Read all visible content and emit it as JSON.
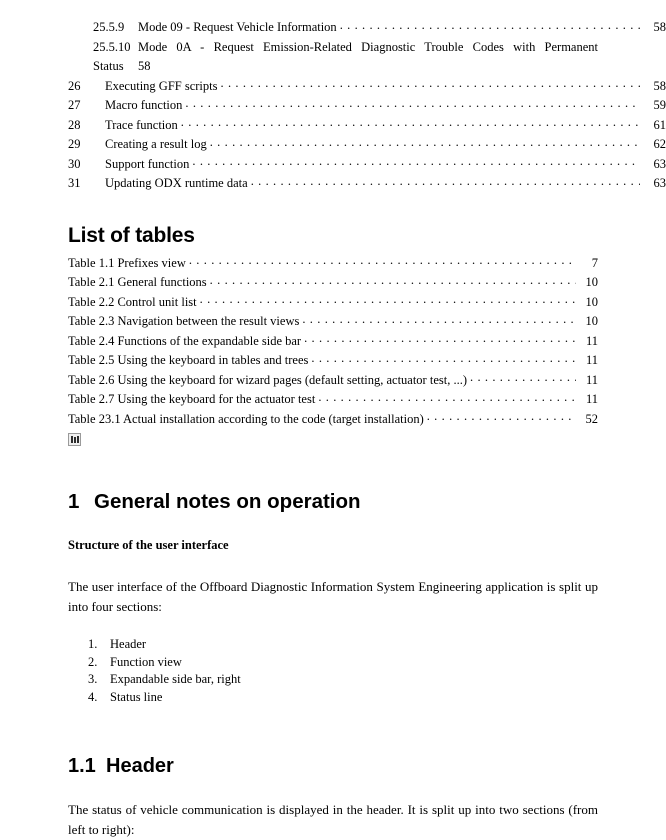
{
  "document": {
    "toc_continued": {
      "sub_entries": [
        {
          "number": "25.5.9",
          "title": "Mode 09 - Request Vehicle Information",
          "page": "58"
        }
      ],
      "wrapped_entry": {
        "number": "25.5.10",
        "title_line1": "Mode 0A - Request Emission-Related Diagnostic Trouble Codes with Permanent",
        "title_line2": "Status",
        "page": "58"
      },
      "chapter_entries": [
        {
          "number": "26",
          "title": "Executing GFF scripts",
          "page": "58"
        },
        {
          "number": "27",
          "title": "Macro function",
          "page": "59"
        },
        {
          "number": "28",
          "title": "Trace function",
          "page": "61"
        },
        {
          "number": "29",
          "title": "Creating a result log",
          "page": "62"
        },
        {
          "number": "30",
          "title": "Support function",
          "page": "63"
        },
        {
          "number": "31",
          "title": "Updating ODX runtime data",
          "page": "63"
        }
      ]
    },
    "list_of_tables": {
      "heading": "List of tables",
      "entries": [
        {
          "title": "Table 1.1 Prefixes view",
          "page": "7"
        },
        {
          "title": "Table 2.1 General functions",
          "page": "10"
        },
        {
          "title": "Table 2.2 Control unit list",
          "page": "10"
        },
        {
          "title": "Table 2.3 Navigation between the result views",
          "page": "10"
        },
        {
          "title": "Table 2.4 Functions of the expandable side bar",
          "page": "11"
        },
        {
          "title": "Table 2.5 Using the keyboard in tables and trees",
          "page": "11"
        },
        {
          "title": "Table 2.6 Using the keyboard for wizard pages (default setting, actuator test, ...)",
          "page": "11"
        },
        {
          "title": "Table 2.7 Using the keyboard for the actuator test",
          "page": "11"
        },
        {
          "title": "Table 23.1 Actual installation according to the code (target installation)",
          "page": "52"
        }
      ]
    },
    "chapter_1": {
      "number": "1",
      "title": "General notes on operation",
      "bold_lead": "Structure of the user interface",
      "paragraph": "The user interface of the Offboard Diagnostic Information System Engineering application is split up into four sections:",
      "list": [
        {
          "marker": "1.",
          "text": "Header"
        },
        {
          "marker": "2.",
          "text": "Function view"
        },
        {
          "marker": "3.",
          "text": "Expandable side bar, right"
        },
        {
          "marker": "4.",
          "text": "Status line"
        }
      ]
    },
    "section_1_1": {
      "number": "1.1",
      "title": "Header",
      "paragraph": "The status of vehicle communication is displayed in the header. It is split up into two sections (from left to right):"
    }
  }
}
